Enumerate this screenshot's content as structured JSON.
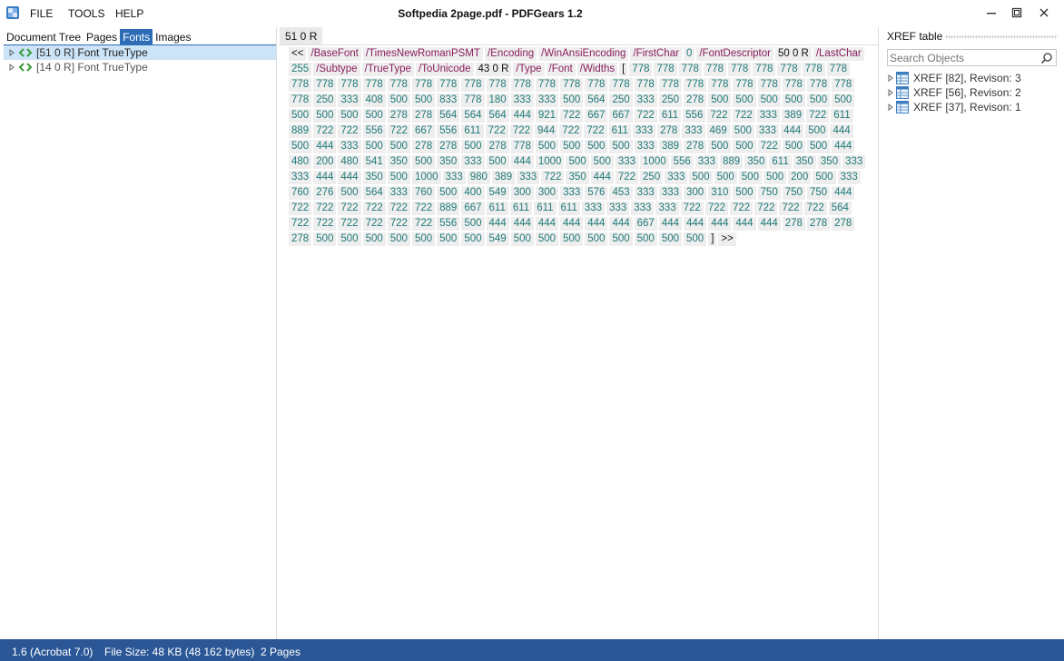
{
  "menu": {
    "file": "FILE",
    "tools": "TOOLS",
    "help": "HELP"
  },
  "window": {
    "title": "Softpedia 2page.pdf - PDFGears 1.2"
  },
  "left_panel": {
    "tabs": [
      {
        "label": "Document Tree",
        "active": false
      },
      {
        "label": "Pages",
        "active": false
      },
      {
        "label": "Fonts",
        "active": true
      },
      {
        "label": "Images",
        "active": false
      }
    ],
    "tree_items": [
      {
        "ref": "[51 0 R]",
        "label": "Font TrueType",
        "selected": true
      },
      {
        "ref": "[14 0 R]",
        "label": "Font TrueType",
        "selected": false
      }
    ]
  },
  "center_panel": {
    "tab_label": "51 0 R",
    "tokens": [
      {
        "t": "<<",
        "k": "punct"
      },
      {
        "t": "/BaseFont",
        "k": "name"
      },
      {
        "t": "/TimesNewRomanPSMT",
        "k": "name"
      },
      {
        "t": "/Encoding",
        "k": "name"
      },
      {
        "t": "/WinAnsiEncoding",
        "k": "name"
      },
      {
        "t": "/FirstChar",
        "k": "name"
      },
      {
        "t": "0",
        "k": "num"
      },
      {
        "t": "/FontDescriptor",
        "k": "name"
      },
      {
        "t": "50 0 R",
        "k": "ref"
      },
      {
        "t": "/LastChar",
        "k": "name"
      },
      {
        "t": "255",
        "k": "num"
      },
      {
        "t": "/Subtype",
        "k": "name"
      },
      {
        "t": "/TrueType",
        "k": "name"
      },
      {
        "t": "/ToUnicode",
        "k": "name"
      },
      {
        "t": "43 0 R",
        "k": "ref"
      },
      {
        "t": "/Type",
        "k": "name"
      },
      {
        "t": "/Font",
        "k": "name"
      },
      {
        "t": "/Widths",
        "k": "name"
      },
      {
        "t": "[",
        "k": "punct"
      }
    ],
    "widths": [
      "778",
      "778",
      "778",
      "778",
      "778",
      "778",
      "778",
      "778",
      "778",
      "778",
      "778",
      "778",
      "778",
      "778",
      "778",
      "778",
      "778",
      "778",
      "778",
      "778",
      "778",
      "778",
      "778",
      "778",
      "778",
      "778",
      "778",
      "778",
      "778",
      "778",
      "778",
      "778",
      "778",
      "250",
      "333",
      "408",
      "500",
      "500",
      "833",
      "778",
      "180",
      "333",
      "333",
      "500",
      "564",
      "250",
      "333",
      "250",
      "278",
      "500",
      "500",
      "500",
      "500",
      "500",
      "500",
      "500",
      "500",
      "500",
      "500",
      "278",
      "278",
      "564",
      "564",
      "564",
      "444",
      "921",
      "722",
      "667",
      "667",
      "722",
      "611",
      "556",
      "722",
      "722",
      "333",
      "389",
      "722",
      "611",
      "889",
      "722",
      "722",
      "556",
      "722",
      "667",
      "556",
      "611",
      "722",
      "722",
      "944",
      "722",
      "722",
      "611",
      "333",
      "278",
      "333",
      "469",
      "500",
      "333",
      "444",
      "500",
      "444",
      "500",
      "444",
      "333",
      "500",
      "500",
      "278",
      "278",
      "500",
      "278",
      "778",
      "500",
      "500",
      "500",
      "500",
      "333",
      "389",
      "278",
      "500",
      "500",
      "722",
      "500",
      "500",
      "444",
      "480",
      "200",
      "480",
      "541",
      "350",
      "500",
      "350",
      "333",
      "500",
      "444",
      "1000",
      "500",
      "500",
      "333",
      "1000",
      "556",
      "333",
      "889",
      "350",
      "611",
      "350",
      "350",
      "333",
      "333",
      "444",
      "444",
      "350",
      "500",
      "1000",
      "333",
      "980",
      "389",
      "333",
      "722",
      "350",
      "444",
      "722",
      "250",
      "333",
      "500",
      "500",
      "500",
      "500",
      "200",
      "500",
      "333",
      "760",
      "276",
      "500",
      "564",
      "333",
      "760",
      "500",
      "400",
      "549",
      "300",
      "300",
      "333",
      "576",
      "453",
      "333",
      "333",
      "300",
      "310",
      "500",
      "750",
      "750",
      "750",
      "444",
      "722",
      "722",
      "722",
      "722",
      "722",
      "722",
      "889",
      "667",
      "611",
      "611",
      "611",
      "611",
      "333",
      "333",
      "333",
      "333",
      "722",
      "722",
      "722",
      "722",
      "722",
      "722",
      "564",
      "722",
      "722",
      "722",
      "722",
      "722",
      "722",
      "556",
      "500",
      "444",
      "444",
      "444",
      "444",
      "444",
      "444",
      "667",
      "444",
      "444",
      "444",
      "444",
      "444",
      "278",
      "278",
      "278",
      "278",
      "500",
      "500",
      "500",
      "500",
      "500",
      "500",
      "500",
      "549",
      "500",
      "500",
      "500",
      "500",
      "500",
      "500",
      "500",
      "500"
    ],
    "closing_tokens": [
      {
        "t": "]",
        "k": "punct"
      },
      {
        "t": ">>",
        "k": "punct"
      }
    ]
  },
  "right_panel": {
    "title": "XREF table",
    "search_placeholder": "Search Objects",
    "items": [
      {
        "label": "XREF [82], Revison: 3"
      },
      {
        "label": "XREF [56], Revison: 2"
      },
      {
        "label": "XREF [37], Revison: 1"
      }
    ]
  },
  "status": {
    "version": "1.6 (Acrobat 7.0)",
    "file_size": "File Size: 48  KB (48 162  bytes)",
    "pages": "2 Pages"
  },
  "colors": {
    "accent": "#2d6db5",
    "statusbar": "#2b5797",
    "name_token": "#8a1f5d",
    "number_token": "#1f7a78",
    "selection": "#cce4f7"
  }
}
